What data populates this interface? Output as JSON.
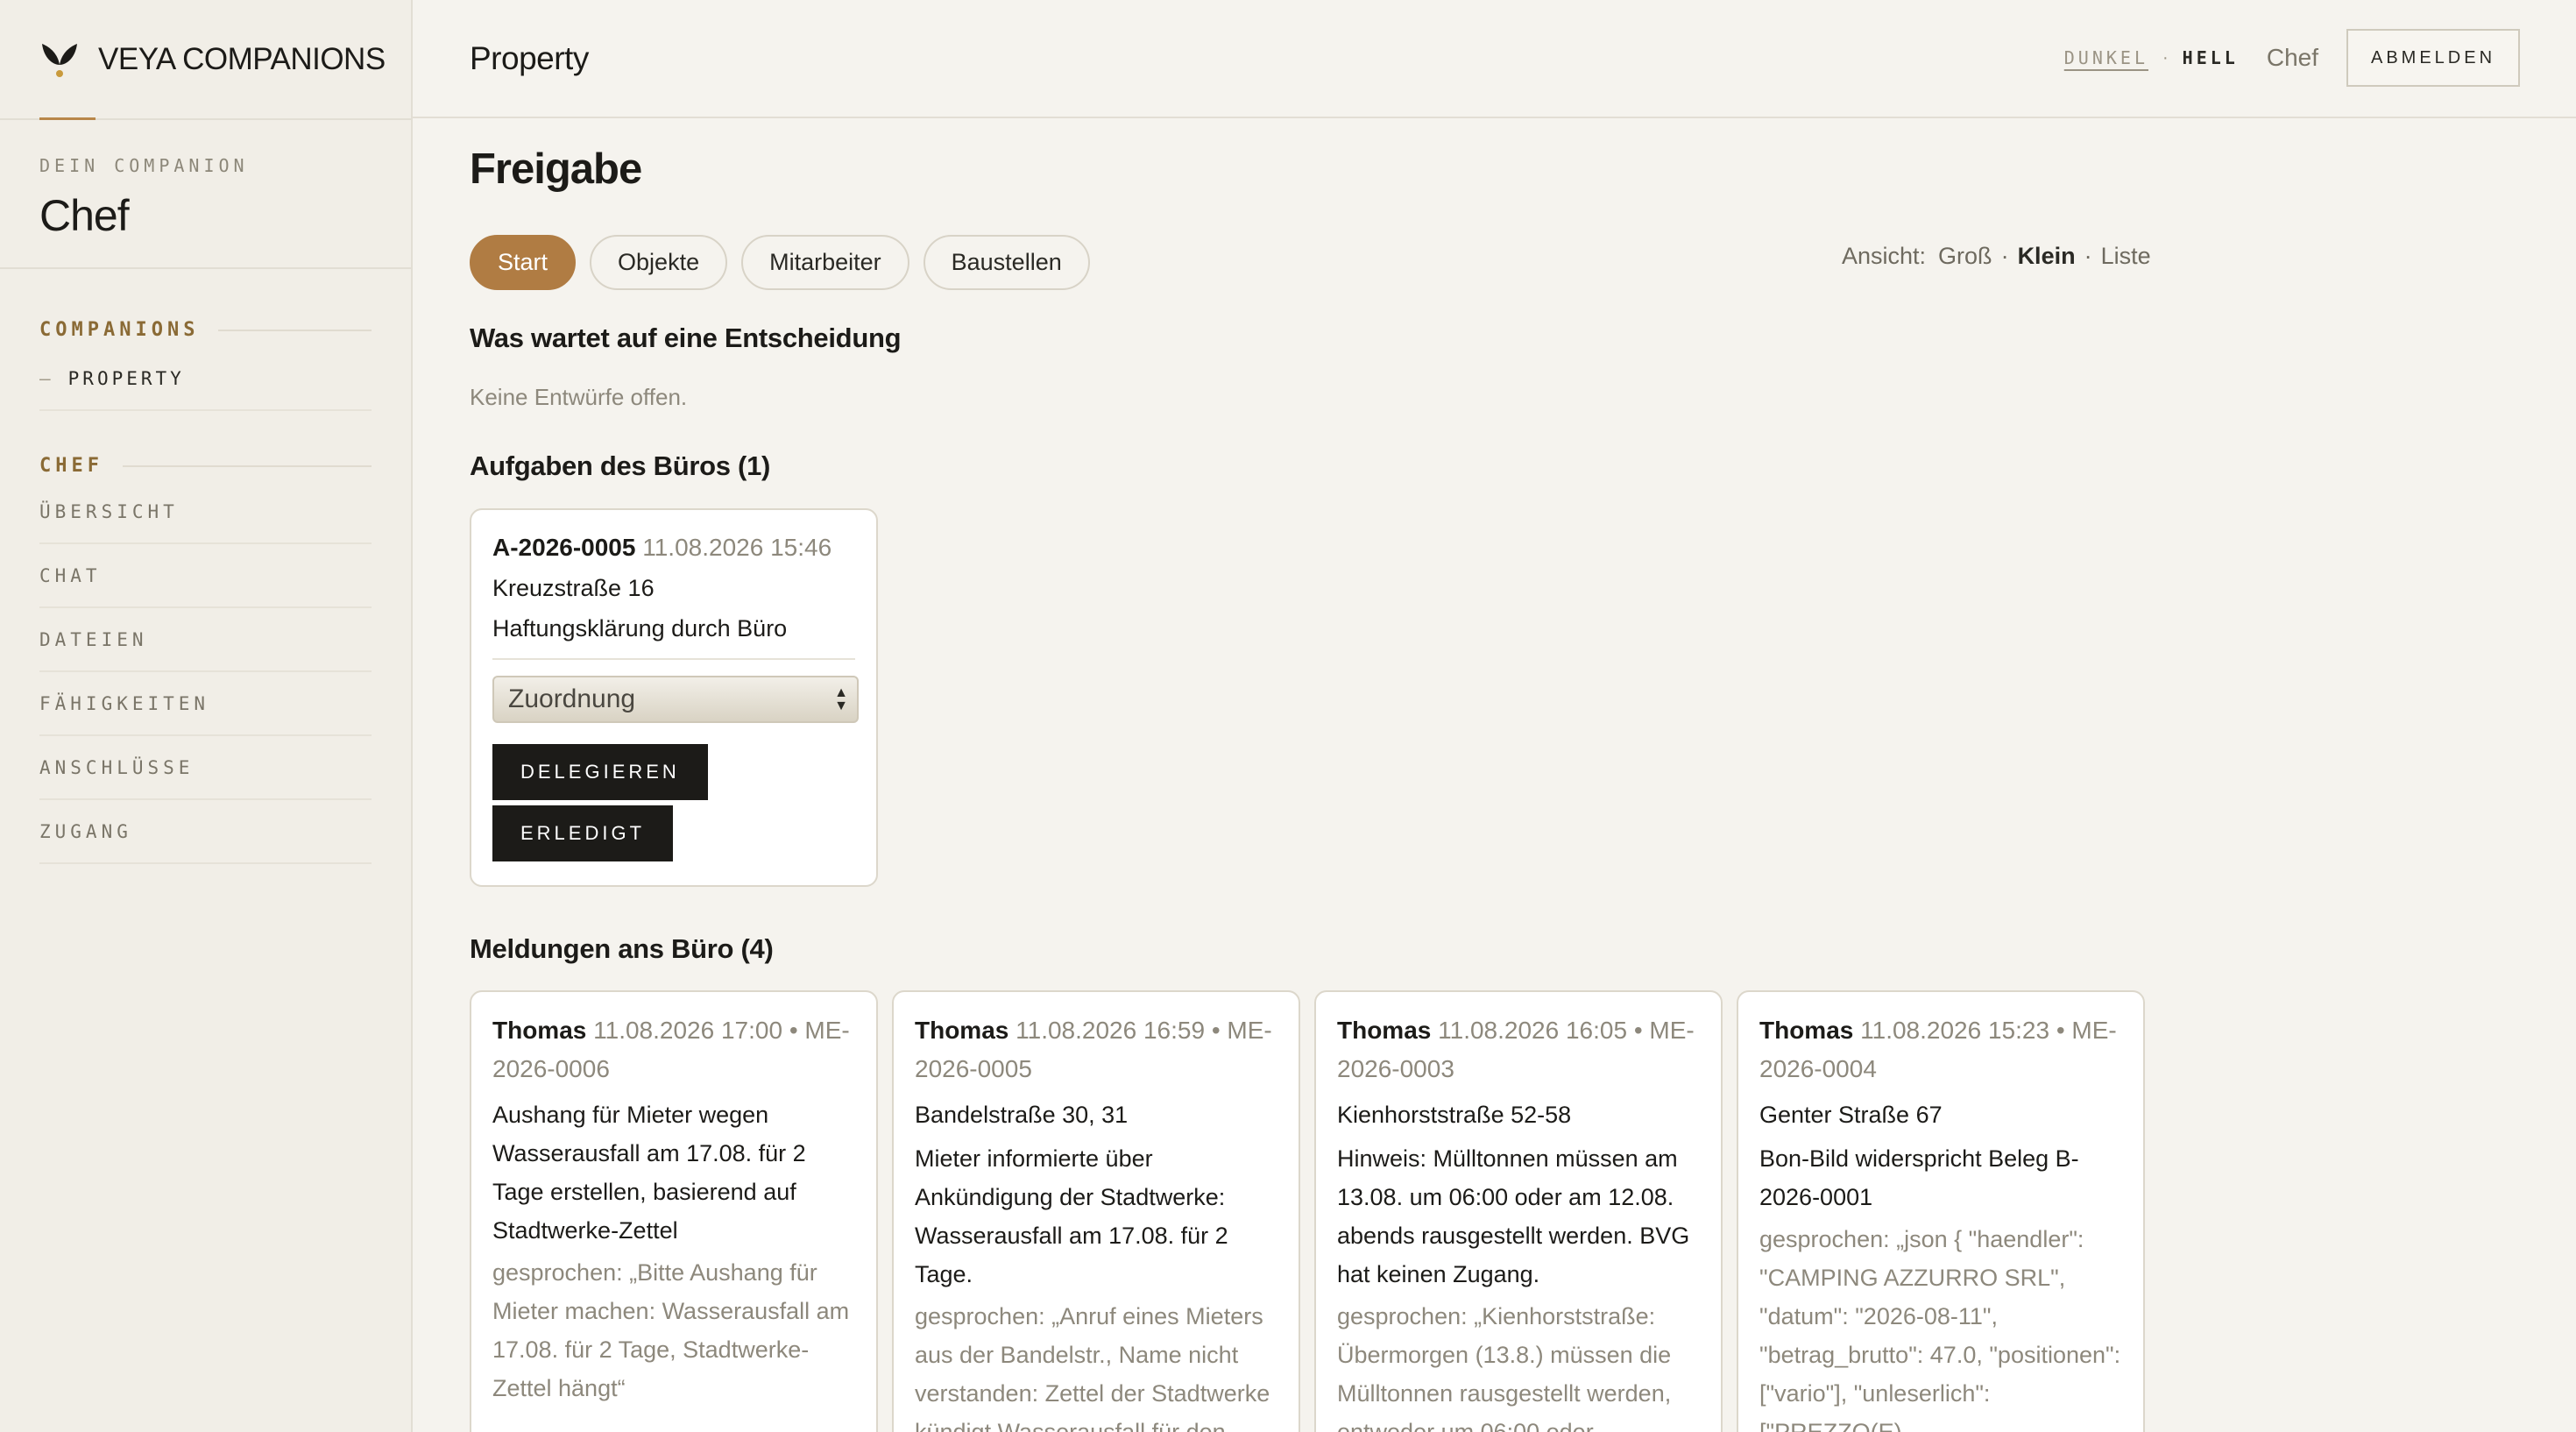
{
  "brand": {
    "name": "VEYA COMPANIONS",
    "logo_icon": "sprout-icon"
  },
  "companion": {
    "kicker": "DEIN COMPANION",
    "name": "Chef"
  },
  "sidebar": {
    "companions_heading": "COMPANIONS",
    "companions_items": [
      {
        "label": "PROPERTY"
      }
    ],
    "chef_heading": "CHEF",
    "chef_items": [
      {
        "label": "ÜBERSICHT"
      },
      {
        "label": "CHAT"
      },
      {
        "label": "DATEIEN"
      },
      {
        "label": "FÄHIGKEITEN"
      },
      {
        "label": "ANSCHLÜSSE"
      },
      {
        "label": "ZUGANG"
      }
    ]
  },
  "topbar": {
    "title": "Property",
    "theme_dark": "DUNKEL",
    "theme_sep": "·",
    "theme_light": "HELL",
    "user": "Chef",
    "logout": "ABMELDEN"
  },
  "main": {
    "page_title": "Freigabe",
    "tabs": [
      {
        "label": "Start",
        "active": true
      },
      {
        "label": "Objekte"
      },
      {
        "label": "Mitarbeiter"
      },
      {
        "label": "Baustellen"
      }
    ],
    "view": {
      "label": "Ansicht:",
      "options": [
        "Groß",
        "Klein",
        "Liste"
      ],
      "selected": "Klein",
      "sep": "·"
    },
    "decision": {
      "heading": "Was wartet auf eine Entscheidung",
      "empty": "Keine Entwürfe offen."
    },
    "tasks": {
      "heading": "Aufgaben des Büros (1)",
      "items": [
        {
          "code": "A-2026-0005",
          "time": "11.08.2026 15:46",
          "address": "Kreuzstraße 16",
          "description": "Haftungsklärung durch Büro",
          "select_value": "Zuordnung",
          "delegate": "DELEGIEREN",
          "done": "ERLEDIGT"
        }
      ]
    },
    "messages": {
      "heading": "Meldungen ans Büro (4)",
      "items": [
        {
          "who": "Thomas",
          "meta": "11.08.2026 17:00 • ME-2026-0006",
          "title": "",
          "body": "Aushang für Mieter wegen Wasserausfall am 17.08. für 2 Tage erstellen, basierend auf Stadtwerke-Zettel",
          "quote": "gesprochen: „Bitte Aushang für Mieter machen: Wasserausfall am 17.08. für 2 Tage, Stadtwerke-Zettel hängt“"
        },
        {
          "who": "Thomas",
          "meta": "11.08.2026 16:59 • ME-2026-0005",
          "title": "Bandelstraße 30, 31",
          "body": "Mieter informierte über Ankündigung der Stadtwerke: Wasserausfall am 17.08. für 2 Tage.",
          "quote": "gesprochen: „Anruf eines Mieters aus der Bandelstr., Name nicht verstanden: Zettel der Stadtwerke kündigt Wasserausfall für den"
        },
        {
          "who": "Thomas",
          "meta": "11.08.2026 16:05 • ME-2026-0003",
          "title": "Kienhorststraße 52-58",
          "body": "Hinweis: Mülltonnen müssen am 13.08. um 06:00 oder am 12.08. abends rausgestellt werden. BVG hat keinen Zugang.",
          "quote": "gesprochen: „Kienhorststraße: Übermorgen (13.8.) müssen die Mülltonnen rausgestellt werden, entweder um 06:00 oder"
        },
        {
          "who": "Thomas",
          "meta": "11.08.2026 15:23 • ME-2026-0004",
          "title": "Genter Straße 67",
          "body": "Bon-Bild widerspricht Beleg B-2026-0001",
          "quote": "gesprochen: „json { \"haendler\": \"CAMPING AZZURRO SRL\", \"datum\": \"2026-08-11\", \"betrag_brutto\": 47.0, \"positionen\": [\"vario\"], \"unleserlich\": [\"PREZZO(E)"
        }
      ]
    }
  }
}
